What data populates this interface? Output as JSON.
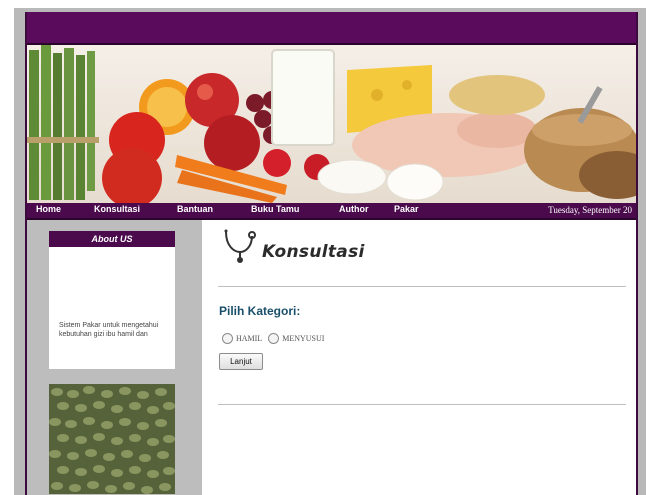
{
  "nav": {
    "items": [
      "Home",
      "Konsultasi",
      "Bantuan",
      "Buku Tamu",
      "Author",
      "Pakar"
    ],
    "date": "Tuesday, September 20"
  },
  "sidebar": {
    "about_title": "About US",
    "about_text": "Sistem Pakar untuk mengetahui kebutuhan gizi ibu hamil dan"
  },
  "main": {
    "page_title": "Konsultasi",
    "title_icon": "stethoscope-icon",
    "category_label": "Pilih Kategori:",
    "options": [
      "HAMIL",
      "MENYUSUI"
    ],
    "submit_label": "Lanjut"
  },
  "colors": {
    "brand_purple": "#5a0b5c",
    "nav_purple": "#4a0a4c",
    "sidebar_gray": "#bdbdbd",
    "heading_blue": "#1a4f6a"
  }
}
